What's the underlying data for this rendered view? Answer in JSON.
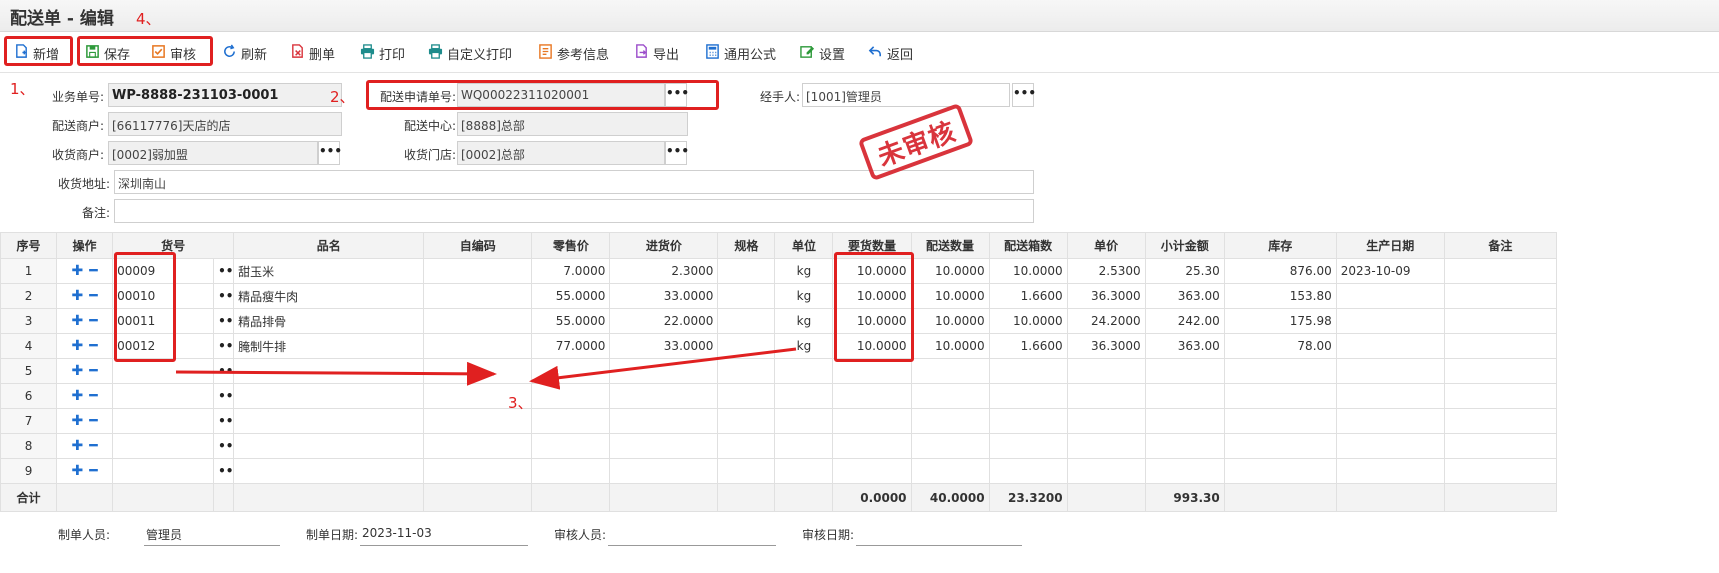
{
  "page": {
    "title": "配送单 - 编辑"
  },
  "toolbar": [
    {
      "label": "新增",
      "icon": "add-doc-icon",
      "color": "#1f6fd0"
    },
    {
      "label": "保存",
      "icon": "save-icon",
      "color": "#2e9a3b"
    },
    {
      "label": "审核",
      "icon": "check-square-icon",
      "color": "#e87722"
    },
    {
      "label": "刷新",
      "icon": "refresh-icon",
      "color": "#1f6fd0"
    },
    {
      "label": "删单",
      "icon": "delete-doc-icon",
      "color": "#d9343c"
    },
    {
      "label": "打印",
      "icon": "print-icon",
      "color": "#1e8c8c"
    },
    {
      "label": "自定义打印",
      "icon": "custom-print-icon",
      "color": "#1e8c8c"
    },
    {
      "label": "参考信息",
      "icon": "reference-icon",
      "color": "#e87722"
    },
    {
      "label": "导出",
      "icon": "export-icon",
      "color": "#9b4dca"
    },
    {
      "label": "通用公式",
      "icon": "calculator-icon",
      "color": "#1f6fd0"
    },
    {
      "label": "设置",
      "icon": "settings-edit-icon",
      "color": "#2e9a3b"
    },
    {
      "label": "返回",
      "icon": "back-icon",
      "color": "#1f6fd0"
    }
  ],
  "annotations": {
    "n1": "1、",
    "n2": "2、",
    "n3": "3、",
    "n4": "4、"
  },
  "form": {
    "doc_no_label": "业务单号:",
    "doc_no": "WP-8888-231103-0001",
    "request_no_label": "配送申请单号:",
    "request_no": "WQ00022311020001",
    "handler_label": "经手人:",
    "handler": "[1001]管理员",
    "vendor_label": "配送商户:",
    "vendor": "[66117776]天店的店",
    "center_label": "配送中心:",
    "center": "[8888]总部",
    "receiver_label": "收货商户:",
    "receiver": "[0002]弱加盟",
    "store_label": "收货门店:",
    "store": "[0002]总部",
    "address_label": "收货地址:",
    "address": "深圳南山",
    "note_label": "备注:",
    "note": ""
  },
  "stamp": {
    "text": "未审核",
    "color": "#d9343c"
  },
  "grid": {
    "headers": [
      "序号",
      "操作",
      "货号",
      "品名",
      "自编码",
      "零售价",
      "进货价",
      "规格",
      "单位",
      "要货数量",
      "配送数量",
      "配送箱数",
      "单价",
      "小计金额",
      "库存",
      "生产日期",
      "备注"
    ],
    "rows": [
      {
        "no": "1",
        "code": "00009",
        "name": "甜玉米",
        "self": "",
        "retail": "7.0000",
        "cost": "2.3000",
        "spec": "",
        "unit": "kg",
        "req": "10.0000",
        "qty": "10.0000",
        "box": "10.0000",
        "price": "2.5300",
        "amount": "25.30",
        "stock": "876.00",
        "date": "2023-10-09",
        "note": ""
      },
      {
        "no": "2",
        "code": "00010",
        "name": "精品瘦牛肉",
        "self": "",
        "retail": "55.0000",
        "cost": "33.0000",
        "spec": "",
        "unit": "kg",
        "req": "10.0000",
        "qty": "10.0000",
        "box": "1.6600",
        "price": "36.3000",
        "amount": "363.00",
        "stock": "153.80",
        "date": "",
        "note": ""
      },
      {
        "no": "3",
        "code": "00011",
        "name": "精品排骨",
        "self": "",
        "retail": "55.0000",
        "cost": "22.0000",
        "spec": "",
        "unit": "kg",
        "req": "10.0000",
        "qty": "10.0000",
        "box": "10.0000",
        "price": "24.2000",
        "amount": "242.00",
        "stock": "175.98",
        "date": "",
        "note": ""
      },
      {
        "no": "4",
        "code": "00012",
        "name": "腌制牛排",
        "self": "",
        "retail": "77.0000",
        "cost": "33.0000",
        "spec": "",
        "unit": "kg",
        "req": "10.0000",
        "qty": "10.0000",
        "box": "1.6600",
        "price": "36.3000",
        "amount": "363.00",
        "stock": "78.00",
        "date": "",
        "note": ""
      },
      {
        "no": "5",
        "code": "",
        "name": "",
        "self": "",
        "retail": "",
        "cost": "",
        "spec": "",
        "unit": "",
        "req": "",
        "qty": "",
        "box": "",
        "price": "",
        "amount": "",
        "stock": "",
        "date": "",
        "note": ""
      },
      {
        "no": "6",
        "code": "",
        "name": "",
        "self": "",
        "retail": "",
        "cost": "",
        "spec": "",
        "unit": "",
        "req": "",
        "qty": "",
        "box": "",
        "price": "",
        "amount": "",
        "stock": "",
        "date": "",
        "note": ""
      },
      {
        "no": "7",
        "code": "",
        "name": "",
        "self": "",
        "retail": "",
        "cost": "",
        "spec": "",
        "unit": "",
        "req": "",
        "qty": "",
        "box": "",
        "price": "",
        "amount": "",
        "stock": "",
        "date": "",
        "note": ""
      },
      {
        "no": "8",
        "code": "",
        "name": "",
        "self": "",
        "retail": "",
        "cost": "",
        "spec": "",
        "unit": "",
        "req": "",
        "qty": "",
        "box": "",
        "price": "",
        "amount": "",
        "stock": "",
        "date": "",
        "note": ""
      },
      {
        "no": "9",
        "code": "",
        "name": "",
        "self": "",
        "retail": "",
        "cost": "",
        "spec": "",
        "unit": "",
        "req": "",
        "qty": "",
        "box": "",
        "price": "",
        "amount": "",
        "stock": "",
        "date": "",
        "note": ""
      }
    ],
    "sum": {
      "label": "合计",
      "req": "0.0000",
      "qty": "40.0000",
      "box": "23.3200",
      "amount": "993.30"
    }
  },
  "footer": {
    "maker_label": "制单人员:",
    "maker": "管理员",
    "make_date_label": "制单日期:",
    "make_date": "2023-11-03",
    "auditor_label": "审核人员:",
    "auditor": "",
    "audit_date_label": "审核日期:",
    "audit_date": ""
  },
  "colors": {
    "annotation_red": "#e02020",
    "plus_minus_blue": "#1f6fd0"
  }
}
